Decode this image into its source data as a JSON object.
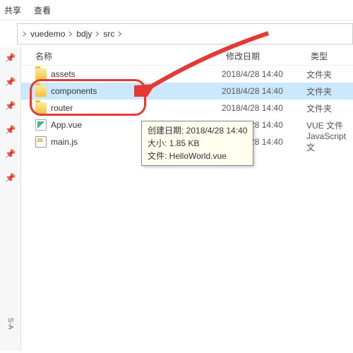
{
  "menubar": {
    "share": "共享",
    "view": "查看"
  },
  "breadcrumb": {
    "items": [
      "vuedemo",
      "bdjy",
      "src"
    ]
  },
  "columns": {
    "name": "名称",
    "date": "修改日期",
    "type": "类型"
  },
  "files": [
    {
      "name": "assets",
      "date": "2018/4/28 14:40",
      "type": "文件夹",
      "icon": "folder"
    },
    {
      "name": "components",
      "date": "2018/4/28 14:40",
      "type": "文件夹",
      "icon": "folder",
      "selected": true
    },
    {
      "name": "router",
      "date": "2018/4/28 14:40",
      "type": "文件夹",
      "icon": "folder"
    },
    {
      "name": "App.vue",
      "date": "2018/4/28 14:40",
      "type": "VUE 文件",
      "icon": "vue"
    },
    {
      "name": "main.js",
      "date": "2018/4/28 14:40",
      "type": "JavaScript 文",
      "icon": "js"
    }
  ],
  "tooltip": {
    "line1": "创建日期: 2018/4/28 14:40",
    "line2": "大小: 1.85 KB",
    "line3": "文件: HelloWorld.vue"
  },
  "sidebar_label": "S-A"
}
